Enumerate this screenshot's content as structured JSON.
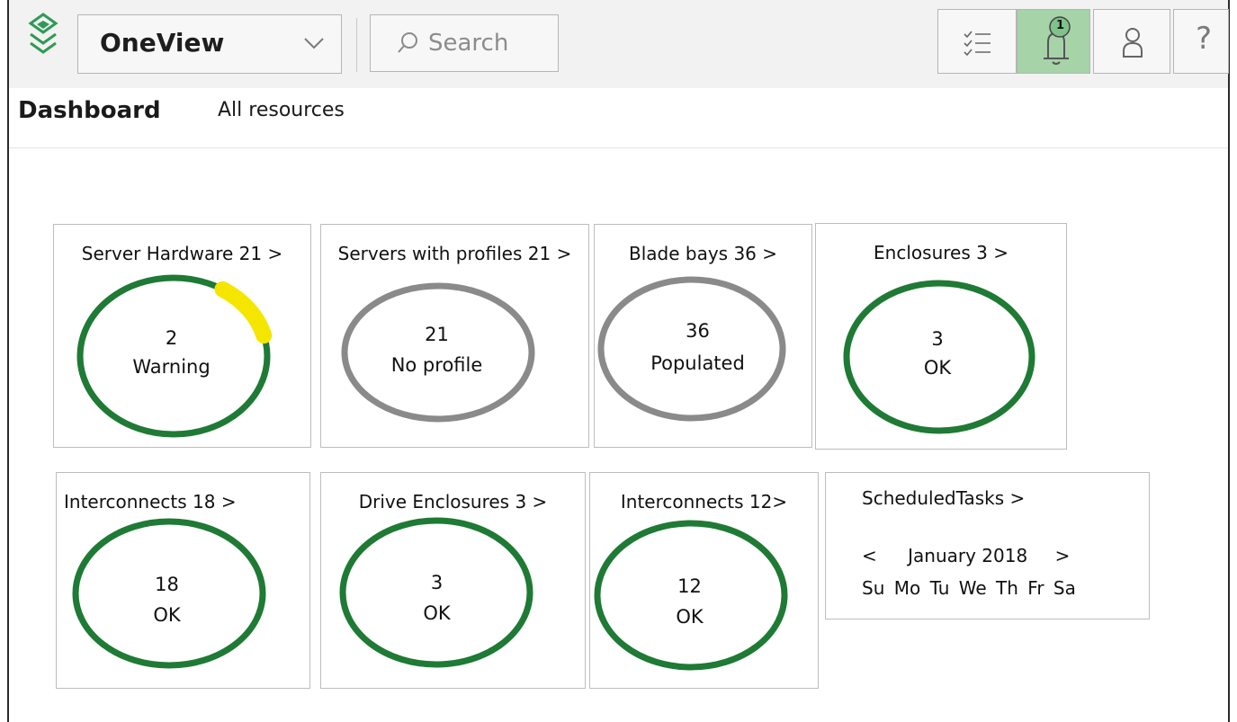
{
  "header": {
    "app_name": "OneView",
    "search_placeholder": "Search",
    "notification_count": "1",
    "help_label": "?"
  },
  "nav": {
    "dashboard": "Dashboard",
    "all_resources": "All resources"
  },
  "cards": [
    {
      "title": "Server Hardware 21 >",
      "value": "2",
      "status": "Warning",
      "ring": "green",
      "warning_fraction": 0.12
    },
    {
      "title": "Servers with profiles 21 >",
      "value": "21",
      "status": "No profile",
      "ring": "gray"
    },
    {
      "title": "Blade bays 36 >",
      "value": "36",
      "status": "Populated",
      "ring": "gray"
    },
    {
      "title": "Enclosures 3 >",
      "value": "3",
      "status": "OK",
      "ring": "green"
    },
    {
      "title": "Interconnects 18 >",
      "value": "18",
      "status": "OK",
      "ring": "green"
    },
    {
      "title": "Drive Enclosures 3 >",
      "value": "3",
      "status": "OK",
      "ring": "green"
    },
    {
      "title": "Interconnects 12>",
      "value": "12",
      "status": "OK",
      "ring": "green"
    }
  ],
  "scheduled": {
    "title": "ScheduledTasks >",
    "prev": "<",
    "month": "January 2018",
    "next": ">",
    "weekdays": "Su Mo Tu We Th Fr Sa"
  },
  "colors": {
    "ok_green": "#1e7a34",
    "neutral_gray": "#8a8a8a",
    "warning_yellow": "#f5e600",
    "active_button": "#a6d3a8"
  },
  "icons": {
    "logo": "layers-icon",
    "dropdown": "chevron-down-icon",
    "search": "search-icon",
    "activity": "checklist-icon",
    "notifications": "bell-icon",
    "user": "user-icon"
  }
}
